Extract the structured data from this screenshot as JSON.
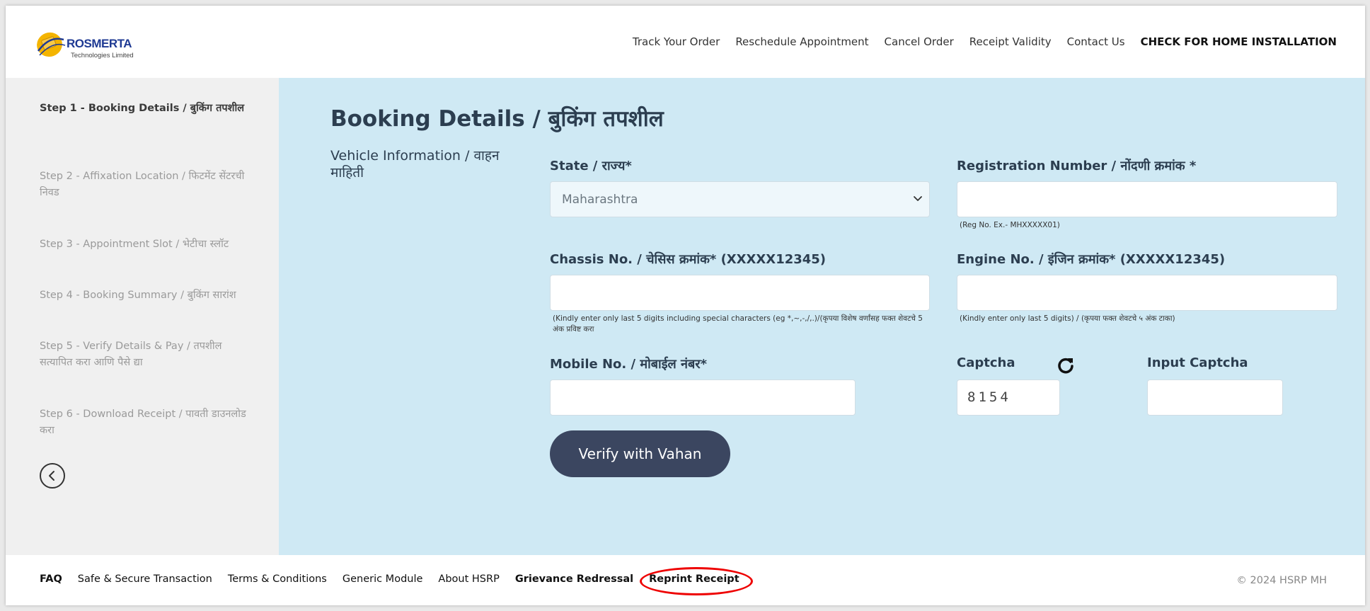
{
  "header": {
    "logo_brand": "ROSMERTA",
    "logo_subtitle": "Technologies Limited",
    "nav": [
      "Track Your Order",
      "Reschedule Appointment",
      "Cancel Order",
      "Receipt Validity",
      "Contact Us",
      "CHECK FOR HOME INSTALLATION"
    ]
  },
  "sidebar": {
    "steps": [
      "Step 1 - Booking Details / बुकिंग तपशील",
      "Step 2 - Affixation Location / फिटमेंट सेंटरची निवड",
      "Step 3 - Appointment Slot / भेटीचा स्लॉट",
      "Step 4 - Booking Summary / बुकिंग सारांश",
      "Step 5 - Verify Details & Pay / तपशील सत्यापित करा आणि पैसे द्या",
      "Step 6 - Download Receipt / पावती डाउनलोड करा"
    ],
    "active_step": 1,
    "back_icon": "chevron-left-circle-icon"
  },
  "main": {
    "title": "Booking Details / बुकिंग तपशील",
    "section_label": "Vehicle Information / वाहन माहिती",
    "state": {
      "label": "State / राज्य*",
      "value": "Maharashtra"
    },
    "registration": {
      "label": "Registration Number / नोंदणी क्रमांक *",
      "value": "",
      "hint": "(Reg No. Ex.- MHXXXXX01)"
    },
    "chassis": {
      "label": "Chassis No. / चेसिस क्रमांक* (XXXXX12345)",
      "value": "",
      "hint": "(Kindly enter only last 5 digits including special characters (eg *,~,-,/,.)/(कृपया विशेष वर्णांसह फक्त शेवटचे 5 अंक प्रविष्ट करा"
    },
    "engine": {
      "label": "Engine No. / इंजिन क्रमांक* (XXXXX12345)",
      "value": "",
      "hint": "(Kindly enter only last 5 digits) / (कृपया फक्त शेवटचे ५ अंक टाका)"
    },
    "mobile": {
      "label": "Mobile No. / मोबाईल नंबर*",
      "value": ""
    },
    "captcha": {
      "label": "Captcha",
      "value": "8154"
    },
    "input_captcha": {
      "label": "Input Captcha",
      "value": ""
    },
    "verify_button": "Verify with Vahan"
  },
  "footer": {
    "links": [
      "FAQ",
      "Safe & Secure Transaction",
      "Terms & Conditions",
      "Generic Module",
      "About HSRP",
      "Grievance Redressal",
      "Reprint Receipt"
    ],
    "copyright": "© 2024 HSRP MH"
  },
  "colors": {
    "main_bg": "#cfe9f4",
    "sidebar_bg": "#f0f0f0",
    "button_bg": "#3b4660",
    "highlight_circle": "#e00000"
  }
}
